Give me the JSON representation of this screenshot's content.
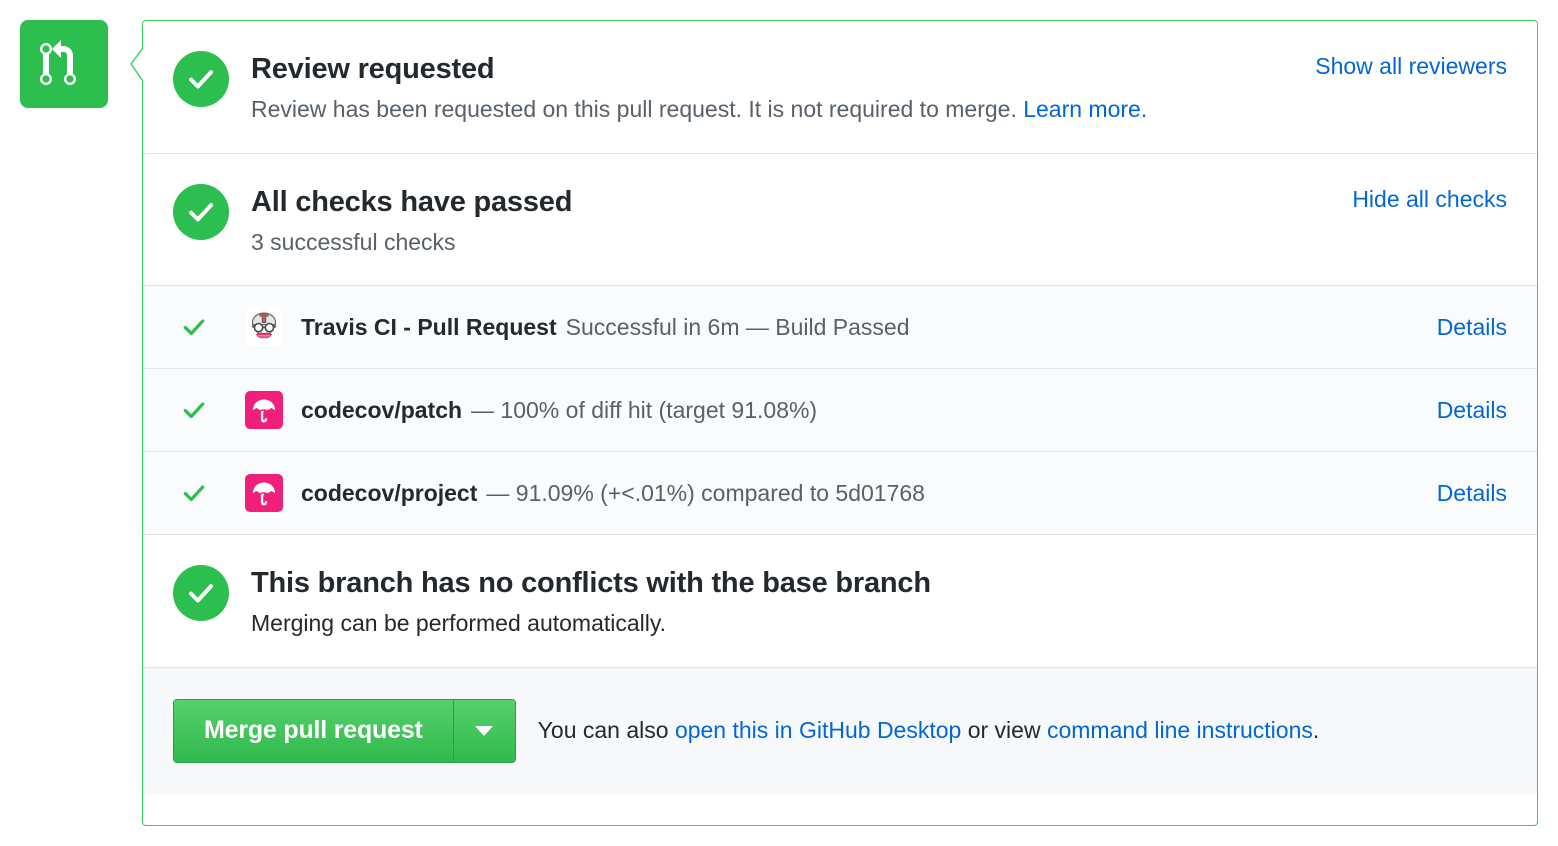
{
  "badge": {
    "icon": "git-pull-request-icon",
    "color": "#2cbe4e"
  },
  "sections": {
    "review": {
      "icon": "check-circle-icon",
      "title": "Review requested",
      "description_prefix": "Review has been requested on this pull request. It is not required to merge. ",
      "description_link": "Learn more.",
      "action_label": "Show all reviewers"
    },
    "checks": {
      "icon": "check-circle-icon",
      "title": "All checks have passed",
      "subtitle": "3 successful checks",
      "action_label": "Hide all checks",
      "rows": [
        {
          "status_icon": "check-icon",
          "avatar": "travis-ci-avatar",
          "name": "Travis CI - Pull Request",
          "description": "Successful in 6m — Build Passed",
          "details_label": "Details"
        },
        {
          "status_icon": "check-icon",
          "avatar": "codecov-avatar",
          "name": "codecov/patch",
          "description": "— 100% of diff hit (target 91.08%)",
          "details_label": "Details"
        },
        {
          "status_icon": "check-icon",
          "avatar": "codecov-avatar",
          "name": "codecov/project",
          "description": "— 91.09% (+<.01%) compared to 5d01768",
          "details_label": "Details"
        }
      ]
    },
    "conflicts": {
      "icon": "check-circle-icon",
      "title": "This branch has no conflicts with the base branch",
      "subtitle": "Merging can be performed automatically."
    }
  },
  "footer": {
    "merge_button_label": "Merge pull request",
    "dropdown_icon": "chevron-down-icon",
    "note_prefix": "You can also ",
    "note_link1": "open this in GitHub Desktop",
    "note_middle": " or view ",
    "note_link2": "command line instructions",
    "note_suffix": "."
  },
  "colors": {
    "success_green": "#2cbe4e",
    "border_green": "#34d058",
    "link_blue": "#0366d6",
    "text_dark": "#24292e",
    "text_muted": "#586069",
    "row_bg": "#fafbfc",
    "footer_bg": "#f6f8fa",
    "codecov_pink": "#f01f7a"
  }
}
